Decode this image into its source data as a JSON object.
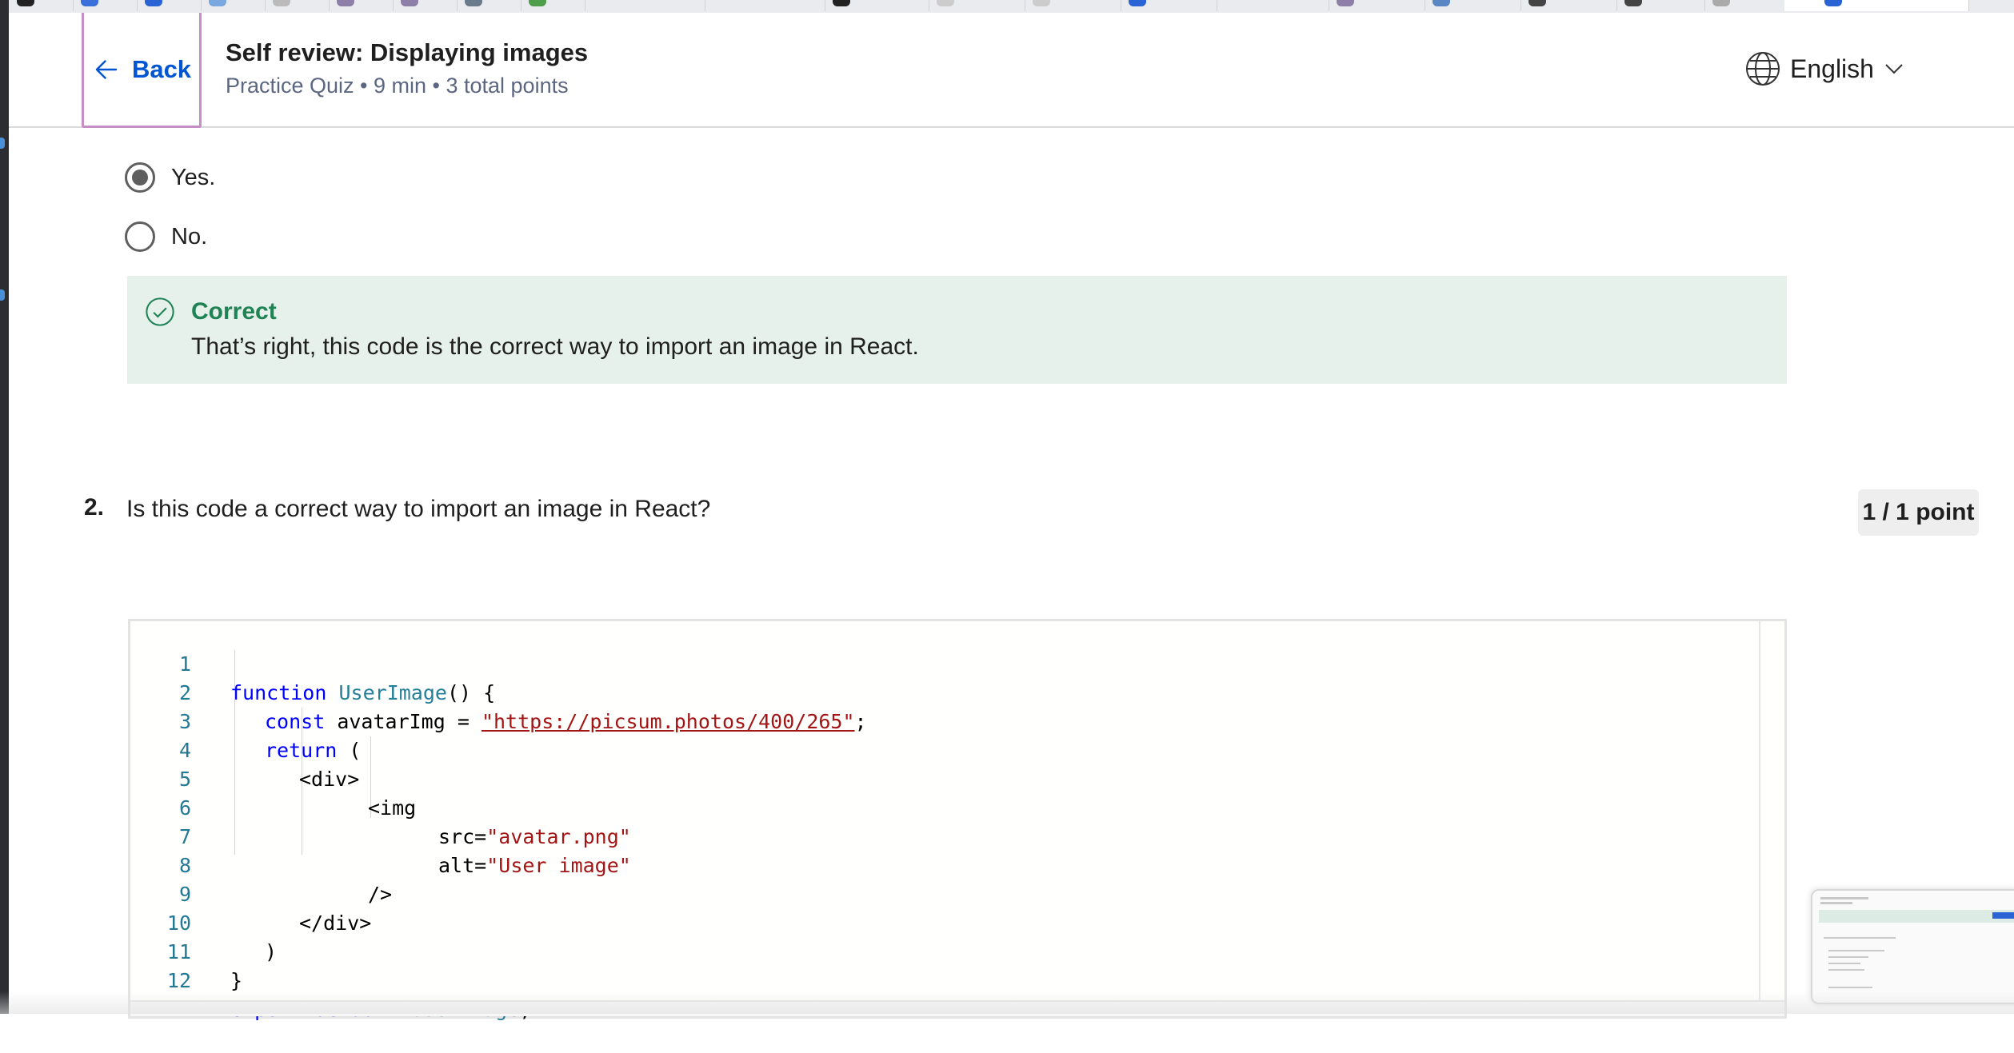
{
  "header": {
    "back_label": "Back",
    "title": "Self review: Displaying images",
    "subtitle": "Practice Quiz • 9 min • 3 total points",
    "language": "English"
  },
  "question1": {
    "options": [
      {
        "label": "Yes.",
        "selected": true
      },
      {
        "label": "No.",
        "selected": false
      }
    ],
    "feedback": {
      "status": "Correct",
      "text": "That’s right, this code is the correct way to import an image in React."
    }
  },
  "question2": {
    "number": "2.",
    "text": "Is this code a correct way to import an image in React?",
    "points": "1 / 1 point"
  },
  "code": {
    "line_numbers": [
      "1",
      "2",
      "3",
      "4",
      "5",
      "6",
      "7",
      "8",
      "9",
      "10",
      "11",
      "12"
    ],
    "lines": [
      {
        "kw1": "function",
        "fn": "UserImage",
        "rest": "() {"
      },
      {
        "kw1": "const",
        "rest": " avatarImg = ",
        "str": "\"https://picsum.photos/400/265\"",
        "end": ";"
      },
      {
        "kw1": "return",
        "rest": " ("
      },
      {
        "rest": "<div>"
      },
      {
        "rest": "<img"
      },
      {
        "rest": "src=",
        "str": "\"avatar.png\""
      },
      {
        "rest": "alt=",
        "str": "\"User image\""
      },
      {
        "rest": "/>"
      },
      {
        "rest": "</div>"
      },
      {
        "rest": ")"
      },
      {
        "rest": "}"
      },
      {
        "kw1": "export",
        "kw2": "default",
        "fn": "UserImage",
        "end": ";"
      }
    ]
  },
  "colors": {
    "accent": "#0056d2",
    "success": "#1f8354",
    "success_bg": "#e7f1ec",
    "focus_outline": "#c78dc5"
  },
  "icons": [
    "back-arrow-icon",
    "globe-icon",
    "chevron-down-icon",
    "check-circle-icon"
  ]
}
